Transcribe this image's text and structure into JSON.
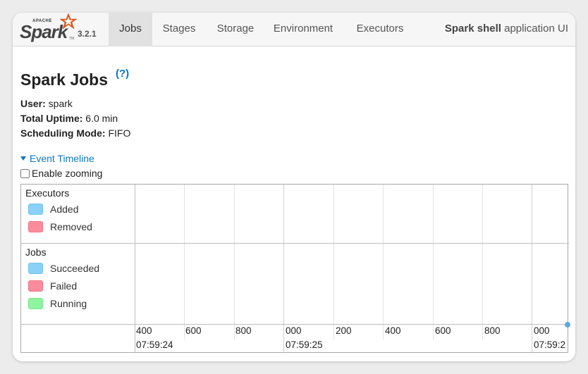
{
  "navbar": {
    "logo_apache": "APACHE",
    "logo_spark": "Spark",
    "logo_tm": "TM",
    "version": "3.2.1",
    "tabs": [
      "Jobs",
      "Stages",
      "Storage",
      "Environment",
      "Executors"
    ],
    "active_tab": "Jobs",
    "app_name": "Spark shell",
    "app_suffix": " application UI"
  },
  "page": {
    "title": "Spark Jobs",
    "help": "(?)"
  },
  "info": {
    "user_label": "User:",
    "user_value": " spark",
    "uptime_label": "Total Uptime:",
    "uptime_value": " 6.0 min",
    "mode_label": "Scheduling Mode:",
    "mode_value": " FIFO"
  },
  "timeline": {
    "toggle_label": "Event Timeline",
    "zoom_label": "Enable zooming",
    "zoom_checked": false,
    "executors": {
      "title": "Executors",
      "legend": [
        {
          "label": "Added",
          "color": "#8bd1f7"
        },
        {
          "label": "Removed",
          "color": "#fb8c9e"
        }
      ]
    },
    "jobs": {
      "title": "Jobs",
      "legend": [
        {
          "label": "Succeeded",
          "color": "#8bd1f7"
        },
        {
          "label": "Failed",
          "color": "#fb8c9e"
        },
        {
          "label": "Running",
          "color": "#90f3a0"
        }
      ]
    },
    "minor_ticks": [
      "400",
      "600",
      "800",
      "000",
      "200",
      "400",
      "600",
      "800",
      "000"
    ],
    "major_ticks": [
      "07:59:24",
      "07:59:25",
      "07:59:2"
    ]
  }
}
